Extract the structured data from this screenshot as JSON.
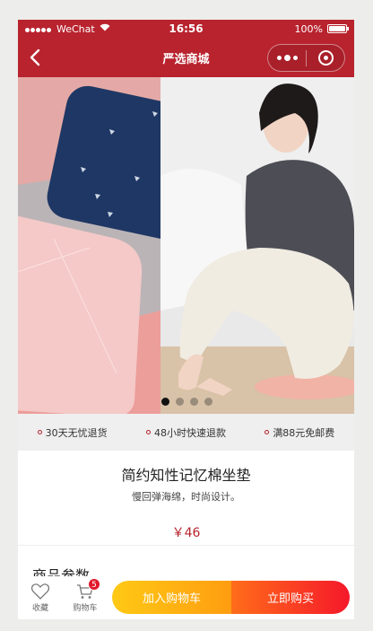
{
  "statusbar": {
    "carrier": "WeChat",
    "time": "16:56",
    "battery": "100%"
  },
  "navbar": {
    "title": "严选商城"
  },
  "banner": {
    "slides": 4,
    "active_index": 0
  },
  "services": [
    {
      "label": "30天无忧退货"
    },
    {
      "label": "48小时快速退款"
    },
    {
      "label": "满88元免邮费"
    }
  ],
  "product": {
    "name": "简约知性记忆棉坐垫",
    "desc": "慢回弹海绵，时尚设计。",
    "price": "￥46"
  },
  "params": {
    "title": "商品参数"
  },
  "bottom": {
    "fav_label": "收藏",
    "cart_label": "购物车",
    "cart_count": "5",
    "add_cart": "加入购物车",
    "buy_now": "立即购买"
  },
  "colors": {
    "brand": "#b8232e",
    "cart_btn": "#ffb011",
    "buy_btn": "#f5182a"
  }
}
